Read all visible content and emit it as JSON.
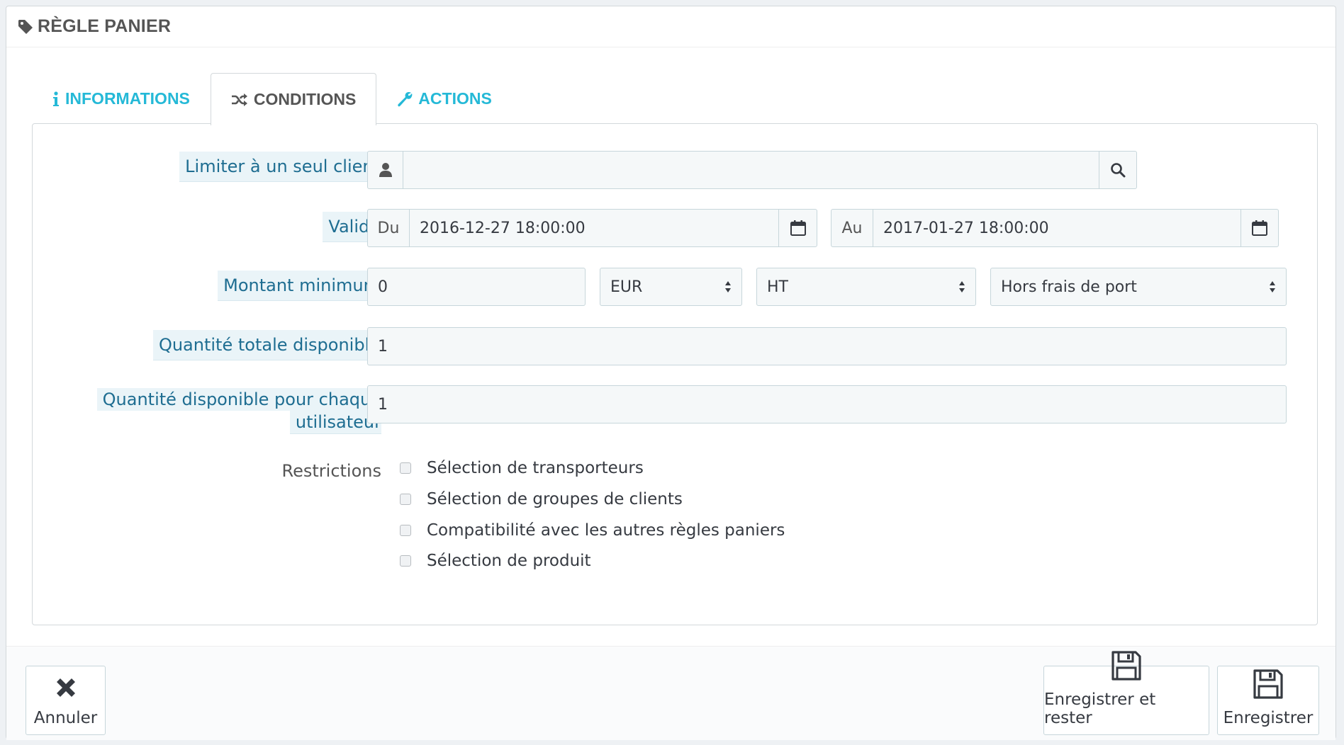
{
  "header": {
    "title": "Règle panier"
  },
  "tabs": [
    {
      "label": "Informations",
      "icon": "info-icon",
      "active": false
    },
    {
      "label": "Conditions",
      "icon": "shuffle-icon",
      "active": true
    },
    {
      "label": "Actions",
      "icon": "wrench-icon",
      "active": false
    }
  ],
  "form": {
    "client": {
      "label": "Limiter à un seul client",
      "value": ""
    },
    "valid": {
      "label": "Valide",
      "from_label": "Du",
      "from_value": "2016-12-27 18:00:00",
      "to_label": "Au",
      "to_value": "2017-01-27 18:00:00"
    },
    "minimum": {
      "label": "Montant minimum",
      "amount": "0",
      "currency": "EUR",
      "tax": "HT",
      "shipping": "Hors frais de port"
    },
    "total_quantity": {
      "label": "Quantité totale disponible",
      "value": "1"
    },
    "per_user": {
      "label_line1": "Quantité disponible pour chaque",
      "label_line2": "utilisateur",
      "value": "1"
    },
    "restrictions": {
      "label": "Restrictions",
      "items": [
        "Sélection de transporteurs",
        "Sélection de groupes de clients",
        "Compatibilité avec les autres règles paniers",
        "Sélection de produit"
      ]
    }
  },
  "footer": {
    "cancel_label": "Annuler",
    "save_stay_label": "Enregistrer et rester",
    "save_label": "Enregistrer"
  },
  "colors": {
    "accent": "#25b9d7",
    "label_bg": "#eaf4f8",
    "label_text": "#1e6d91"
  }
}
